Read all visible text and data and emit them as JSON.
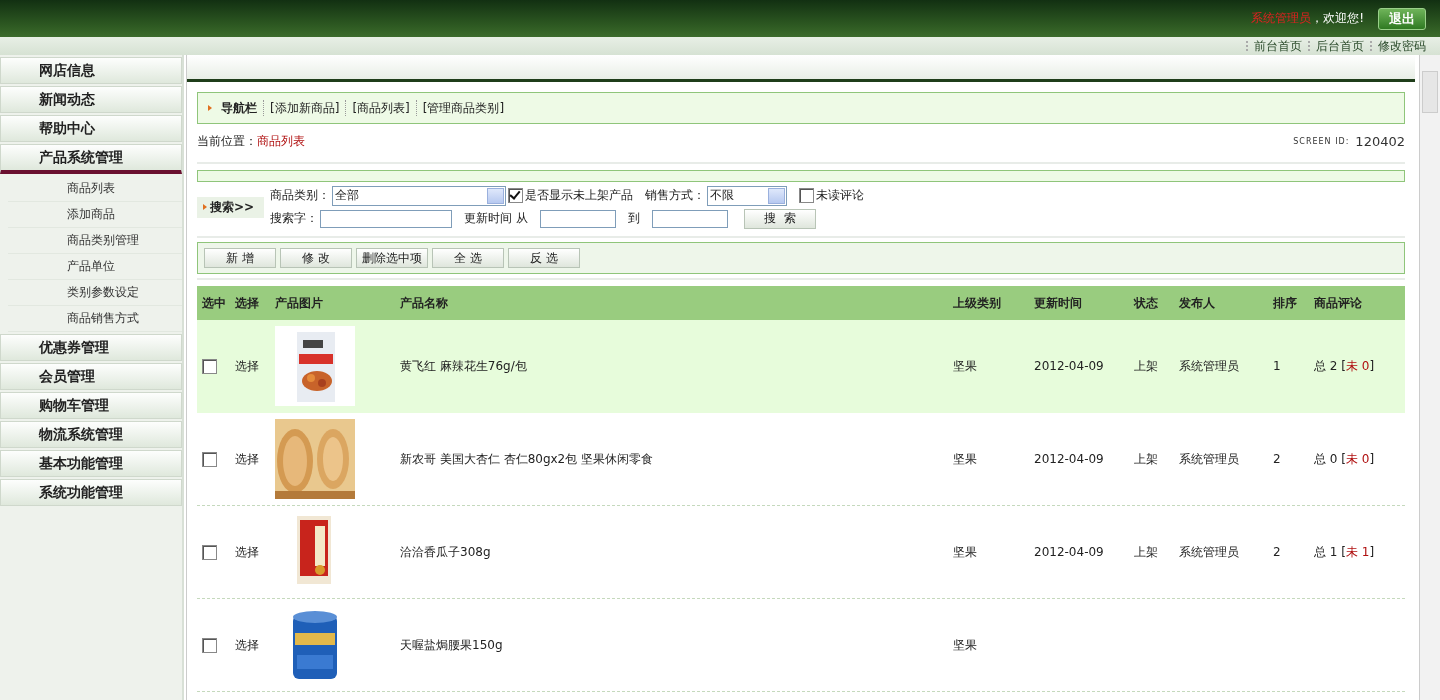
{
  "header": {
    "user": "系统管理员",
    "welcome": "，欢迎您!",
    "logout": "退出",
    "links": [
      "前台首页",
      "后台首页",
      "修改密码"
    ]
  },
  "sidebar": {
    "items": [
      {
        "label": "网店信息",
        "expanded": false
      },
      {
        "label": "新闻动态",
        "expanded": false
      },
      {
        "label": "帮助中心",
        "expanded": false
      },
      {
        "label": "产品系统管理",
        "expanded": true,
        "children": [
          {
            "label": "商品列表"
          },
          {
            "label": "添加商品"
          },
          {
            "label": "商品类别管理"
          },
          {
            "label": "产品单位"
          },
          {
            "label": "类别参数设定"
          },
          {
            "label": "商品销售方式"
          }
        ]
      },
      {
        "label": "优惠券管理",
        "expanded": false
      },
      {
        "label": "会员管理",
        "expanded": false
      },
      {
        "label": "购物车管理",
        "expanded": false
      },
      {
        "label": "物流系统管理",
        "expanded": false
      },
      {
        "label": "基本功能管理",
        "expanded": false
      },
      {
        "label": "系统功能管理",
        "expanded": false
      }
    ]
  },
  "navbar": {
    "title": "导航栏",
    "links": [
      "[添加新商品]",
      "[商品列表]",
      "[管理商品类别]"
    ]
  },
  "location": {
    "label": "当前位置：",
    "current": "商品列表",
    "screen_id_label": "SCREEN ID:",
    "screen_id": "120402"
  },
  "search": {
    "title": "搜索>>",
    "category_label": "商品类别：",
    "category_value": "全部",
    "show_unlisted": {
      "label": "是否显示未上架产品",
      "checked": true
    },
    "sale_label": "销售方式：",
    "sale_value": "不限",
    "unread": {
      "label": "未读评论",
      "checked": false
    },
    "keyword_label": "搜索字：",
    "time_label": "更新时间 从",
    "to_label": "到",
    "button": "搜  索"
  },
  "actions": [
    "新 增",
    "修 改",
    "删除选中项",
    "全 选",
    "反 选"
  ],
  "table": {
    "columns": [
      "选中",
      "选择",
      "产品图片",
      "产品名称",
      "上级类别",
      "更新时间",
      "状态",
      "发布人",
      "排序",
      "商品评论"
    ],
    "rows": [
      {
        "checked": false,
        "highlighted": true,
        "select": "选择",
        "image": {
          "kind": "bag"
        },
        "name": "黄飞红 麻辣花生76g/包",
        "category": "坚果",
        "date": "2012-04-09",
        "status": "上架",
        "publisher": "系统管理员",
        "sort": "1",
        "total": "总 2",
        "unread": "[未 0]"
      },
      {
        "checked": false,
        "highlighted": false,
        "select": "选择",
        "image": {
          "kind": "almond"
        },
        "name": "新农哥 美国大杏仁 杏仁80gx2包 坚果休闲零食",
        "category": "坚果",
        "date": "2012-04-09",
        "status": "上架",
        "publisher": "系统管理员",
        "sort": "2",
        "total": "总 0",
        "unread": "[未 0]"
      },
      {
        "checked": false,
        "highlighted": false,
        "select": "选择",
        "image": {
          "kind": "redbag"
        },
        "name": "洽洽香瓜子308g",
        "category": "坚果",
        "date": "2012-04-09",
        "status": "上架",
        "publisher": "系统管理员",
        "sort": "2",
        "total": "总 1",
        "unread": "[未 1]"
      },
      {
        "checked": false,
        "highlighted": false,
        "select": "选择",
        "image": {
          "kind": "can"
        },
        "name": "天喔盐焗腰果150g",
        "category": "坚果"
      }
    ]
  }
}
